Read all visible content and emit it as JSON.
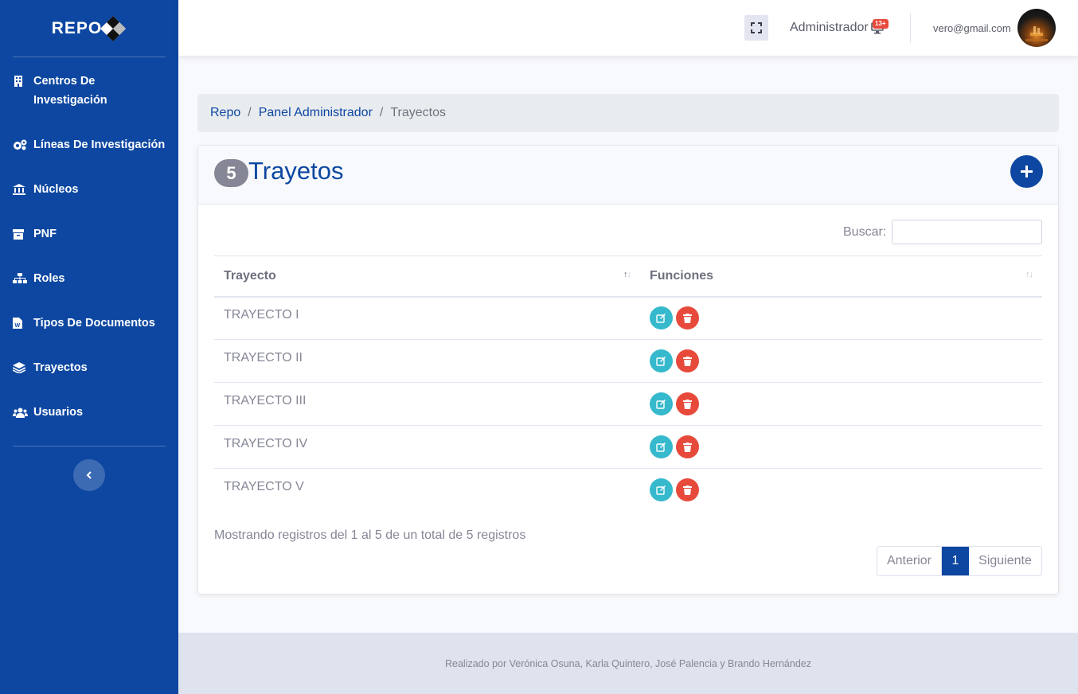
{
  "brand": {
    "name": "REPO"
  },
  "sidebar": {
    "items": [
      {
        "label": "Centros De Investigación",
        "icon": "building-icon"
      },
      {
        "label": "Líneas De Investigación",
        "icon": "cogs-icon"
      },
      {
        "label": "Núcleos",
        "icon": "university-icon"
      },
      {
        "label": "PNF",
        "icon": "archive-icon"
      },
      {
        "label": "Roles",
        "icon": "sitemap-icon"
      },
      {
        "label": "Tipos De Documentos",
        "icon": "file-word-icon"
      },
      {
        "label": "Trayectos",
        "icon": "layer-group-icon"
      },
      {
        "label": "Usuarios",
        "icon": "users-icon"
      }
    ],
    "toggle_icon": "chevron-left-icon"
  },
  "topbar": {
    "role": "Administrador",
    "notification_count": "13+",
    "email": "vero@gmail.com"
  },
  "breadcrumb": {
    "items": [
      "Repo",
      "Panel Administrador"
    ],
    "active": "Trayectos"
  },
  "card": {
    "count": "5",
    "title": "Trayetos",
    "search_label": "Buscar:",
    "search_value": "",
    "columns": [
      "Trayecto",
      "Funciones"
    ],
    "rows": [
      "TRAYECTO I",
      "TRAYECTO II",
      "TRAYECTO III",
      "TRAYECTO IV",
      "TRAYECTO V"
    ],
    "info": "Mostrando registros del 1 al 5 de un total de 5 registros",
    "pagination": {
      "prev": "Anterior",
      "current": "1",
      "next": "Siguiente"
    }
  },
  "footer": {
    "text": "Realizado por Verónica Osuna, Karla Quintero, José Palencia y Brando Hernández"
  },
  "colors": {
    "primary": "#0d47a1",
    "edit": "#36b9cc",
    "delete": "#e74a3b"
  }
}
